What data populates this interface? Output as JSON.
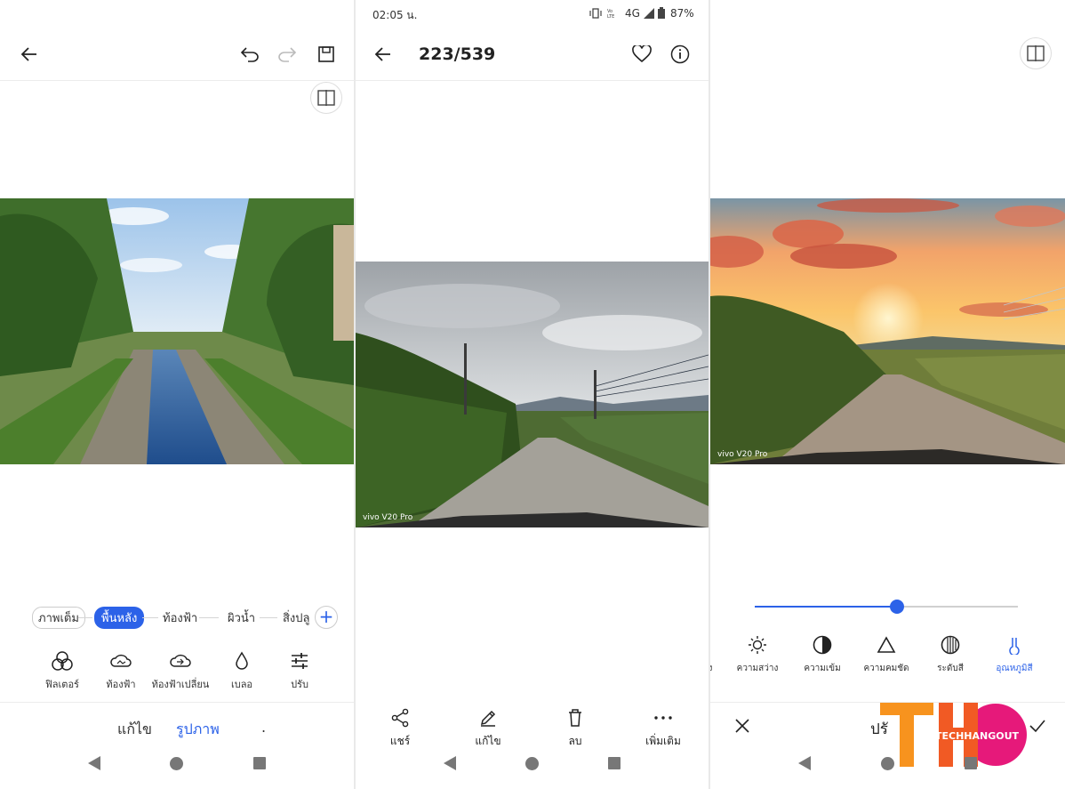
{
  "panel1": {
    "segments": [
      "ภาพเต็ม",
      "พื้นหลัง",
      "ท้องฟ้า",
      "ผิวน้ำ",
      "สิ่งปลู"
    ],
    "active_segment": "พื้นหลัง",
    "tools": [
      "ฟิลเตอร์",
      "ท้องฟ้า",
      "ท้องฟ้าเปลี่ยน",
      "เบลอ",
      "ปรับ"
    ],
    "tabs": [
      "แก้ไข",
      "รูปภาพ",
      "."
    ],
    "active_tab": "รูปภาพ",
    "icons": [
      "arrow-left-icon",
      "undo-icon",
      "redo-icon",
      "save-icon",
      "compare-icon",
      "plus-icon"
    ]
  },
  "panel2": {
    "status": {
      "time": "02:05 น.",
      "network": "4G",
      "battery": "87%"
    },
    "counter": "223/539",
    "watermark": "vivo V20 Pro",
    "actions": [
      "แชร์",
      "แก้ไข",
      "ลบ",
      "เพิ่มเติม"
    ],
    "icons": [
      "arrow-left-icon",
      "heart-icon",
      "info-icon",
      "share-icon",
      "pencil-icon",
      "trash-icon",
      "more-icon"
    ]
  },
  "panel3": {
    "watermark": "vivo V20 Pro",
    "slider_value": 0.54,
    "adjustments": [
      "ง",
      "ความสว่าง",
      "ความเข้ม",
      "ความคมชัด",
      "ระดับสี",
      "อุณหภูมิสี"
    ],
    "active_adjustment": "อุณหภูมิสี",
    "bottom_label": "ปรั",
    "logo_text": "TECHHANGOUT",
    "icons": [
      "compare-icon",
      "close-icon",
      "check-icon"
    ]
  },
  "colors": {
    "accent": "#2c62e8",
    "logo_orange": "#f7931e",
    "logo_pink": "#e6197a"
  }
}
